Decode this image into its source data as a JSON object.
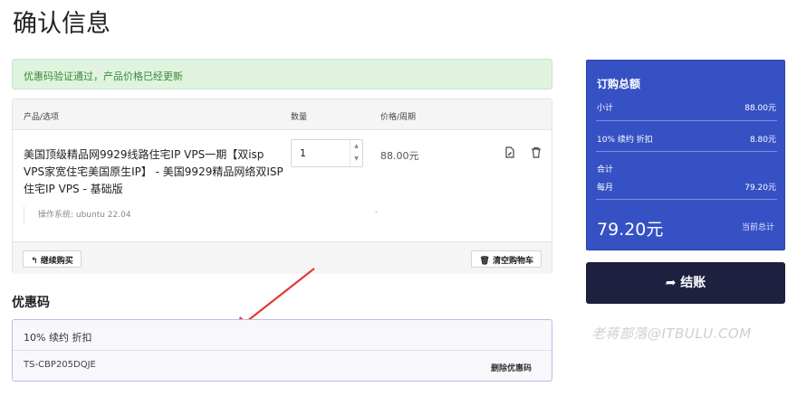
{
  "page": {
    "title": "确认信息"
  },
  "alert": {
    "text": "优惠码验证通过，产品价格已经更新"
  },
  "cart": {
    "headers": {
      "product": "产品/选项",
      "qty": "数量",
      "price": "价格/周期"
    },
    "item": {
      "name": "美国顶级精品网9929线路住宅IP VPS一期【双isp VPS家宽住宅美国原生IP】 - 美国9929精品网络双ISP住宅IP VPS - 基础版",
      "option": "操作系统: ubuntu 22.04",
      "quantity": "1",
      "price": "88.00元",
      "option_price": "-"
    },
    "continue_label": "继续购买",
    "empty_label": "清空购物车"
  },
  "coupon": {
    "heading": "优惠码",
    "description": "10% 续约 折扣",
    "code": "TS-CBP205DQJE",
    "remove_label": "删除优惠码"
  },
  "summary": {
    "title": "订购总额",
    "subtotal_label": "小计",
    "subtotal_value": "88.00元",
    "discount_label": "10% 续约 折扣",
    "discount_value": "8.80元",
    "total_label": "合计",
    "cycle_label": "每月",
    "cycle_value": "79.20元",
    "grand_total": "79.20元",
    "grand_total_label": "当前总计"
  },
  "checkout": {
    "label": "结账"
  },
  "watermark": {
    "text": "老蒋部落@ITBULU.COM"
  },
  "colors": {
    "summary_bg": "#3651c4",
    "checkout_bg": "#1e2040",
    "alert_bg": "#dff3df",
    "arrow": "#e53935"
  }
}
